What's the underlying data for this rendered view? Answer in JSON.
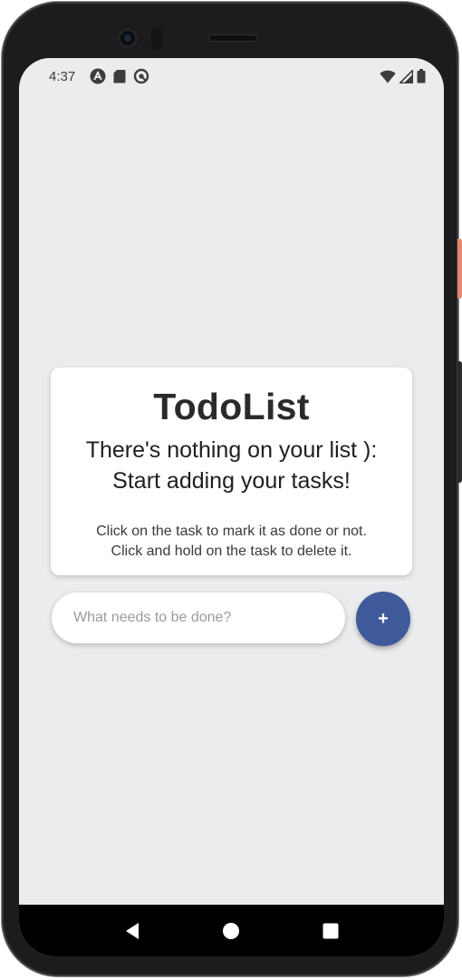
{
  "status_bar": {
    "time": "4:37",
    "left_icons": [
      "a-circle-icon",
      "sd-card-icon",
      "data-saver-icon"
    ],
    "right_icons": [
      "wifi-icon",
      "signal-icon",
      "battery-icon"
    ]
  },
  "card": {
    "title": "TodoList",
    "empty_line1": "There's nothing on your list ):",
    "empty_line2": "Start adding your tasks!",
    "help_line1": "Click on the task to mark it as done or not.",
    "help_line2": "Click and hold on the task to delete it."
  },
  "input": {
    "placeholder": "What needs to be done?",
    "value": ""
  },
  "add_button": {
    "label": "+",
    "color": "#3e5a9a"
  },
  "nav": {
    "back": "back-icon",
    "home": "home-icon",
    "recents": "recents-icon"
  },
  "colors": {
    "background": "#ebecee",
    "card": "#ffffff",
    "accent": "#3e5a9a"
  }
}
